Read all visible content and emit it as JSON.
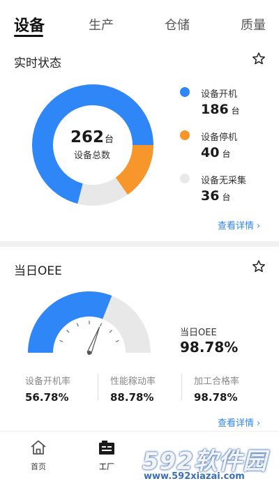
{
  "tabs": [
    {
      "label": "设备",
      "active": true
    },
    {
      "label": "生产",
      "active": false
    },
    {
      "label": "仓储",
      "active": false
    },
    {
      "label": "质量",
      "active": false
    }
  ],
  "status_section": {
    "title": "实时状态",
    "total": {
      "value": "262",
      "unit": "台",
      "label": "设备总数"
    },
    "legend": [
      {
        "label": "设备开机",
        "value": "186",
        "unit": "台",
        "color": "#2f86f6"
      },
      {
        "label": "设备停机",
        "value": "40",
        "unit": "台",
        "color": "#f7962a"
      },
      {
        "label": "设备无采集",
        "value": "36",
        "unit": "台",
        "color": "#e8e8e8"
      }
    ],
    "link": "查看详情"
  },
  "oee_section": {
    "title": "当日OEE",
    "label": "当日OEE",
    "value": "98.78%",
    "gauge_fraction": 0.62,
    "metrics": [
      {
        "label": "设备开机率",
        "value": "56.78%"
      },
      {
        "label": "性能稼动率",
        "value": "88.78%"
      },
      {
        "label": "加工合格率",
        "value": "98.78%"
      }
    ],
    "link": "查看详情"
  },
  "bottom_nav": [
    {
      "label": "首页",
      "icon": "home-icon"
    },
    {
      "label": "工厂",
      "icon": "factory-icon"
    }
  ],
  "watermark": {
    "big": "592软件园",
    "small": "www.592xiazai.com"
  },
  "colors": {
    "accent": "#2f86f6",
    "orange": "#f7962a",
    "grey": "#e8e8e8"
  }
}
